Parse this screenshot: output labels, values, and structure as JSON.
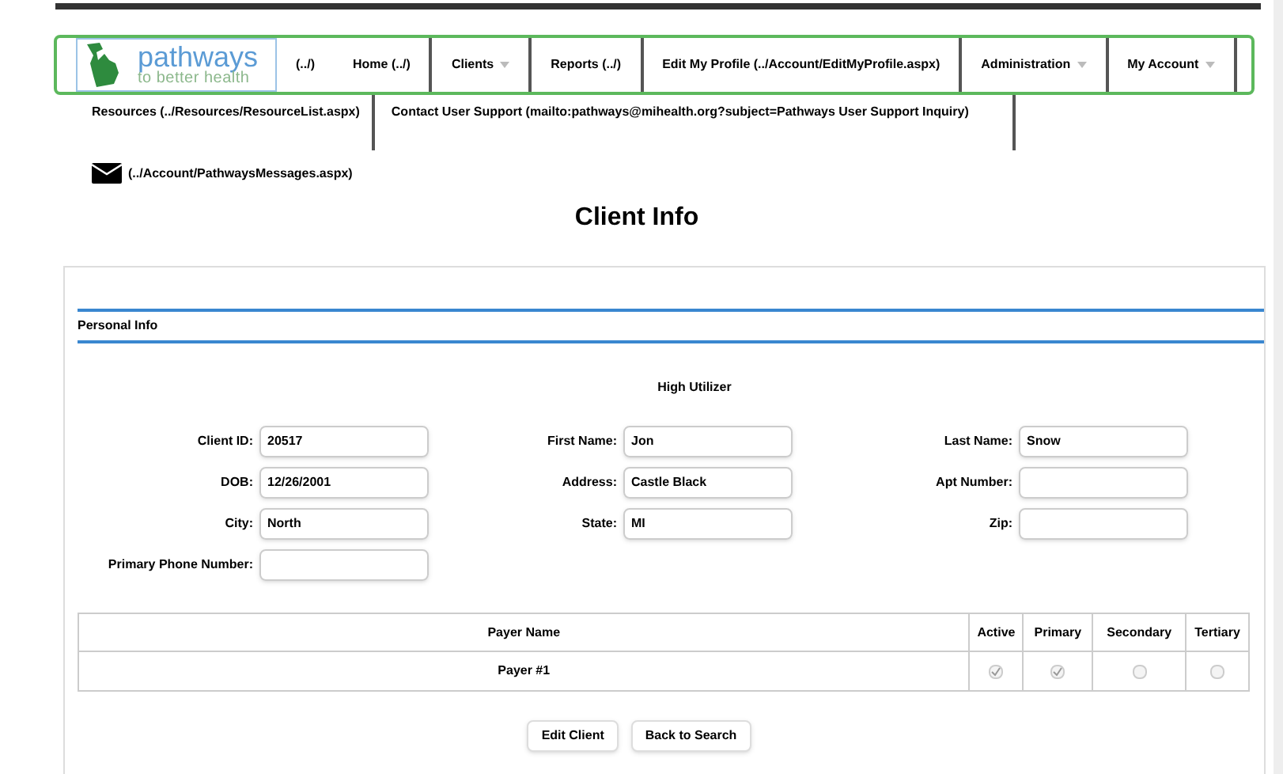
{
  "logo": {
    "name": "pathways",
    "tagline": "to better health"
  },
  "nav": [
    {
      "label": "(../)",
      "dropdown": false
    },
    {
      "label": "Home (../)",
      "dropdown": false
    },
    {
      "label": "Clients",
      "dropdown": true
    },
    {
      "label": "Reports (../)",
      "dropdown": false
    },
    {
      "label": "Edit My Profile (../Account/EditMyProfile.aspx)",
      "dropdown": false
    },
    {
      "label": "Administration",
      "dropdown": true
    },
    {
      "label": "My Account",
      "dropdown": true
    }
  ],
  "nav_row2": [
    "Resources (../Resources/ResourceList.aspx)",
    "Contact User Support (mailto:pathways@mihealth.org?subject=Pathways User Support Inquiry)"
  ],
  "messages_link": "(../Account/PathwaysMessages.aspx)",
  "page_title": "Client Info",
  "section_title": "Personal Info",
  "flag": "High Utilizer",
  "fields": [
    {
      "label": "Client ID:",
      "value": "20517"
    },
    {
      "label": "First Name:",
      "value": "Jon"
    },
    {
      "label": "Last Name:",
      "value": "Snow"
    },
    {
      "label": "DOB:",
      "value": "12/26/2001"
    },
    {
      "label": "Address:",
      "value": "Castle Black"
    },
    {
      "label": "Apt Number:"
    },
    {
      "label": "City:",
      "value": "North"
    },
    {
      "label": "State:",
      "value": "MI"
    },
    {
      "label": "Zip:"
    },
    {
      "label": "Primary Phone Number:"
    }
  ],
  "table": {
    "columns": [
      "Payer Name",
      "Active",
      "Primary",
      "Secondary",
      "Tertiary"
    ],
    "rows": [
      {
        "payer_name": "Payer #1",
        "active": true,
        "primary": true,
        "secondary": false,
        "tertiary": false
      }
    ]
  },
  "buttons": [
    "Edit Client",
    "Back to Search"
  ]
}
